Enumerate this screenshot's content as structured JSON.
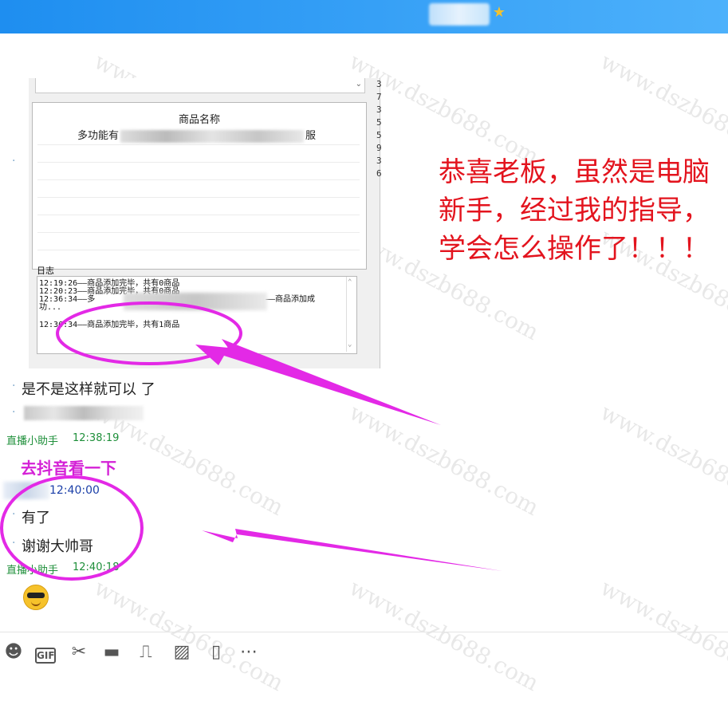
{
  "window": {
    "vip_icon": "vip-star-icon"
  },
  "watermark": "www.dszb688.com",
  "screenshot": {
    "product_header": "商品名称",
    "product_prefix": "多功能有",
    "product_suffix": "服",
    "log_label": "日志",
    "log_lines": [
      "12:19:26——商品添加完毕，共有0商品",
      "12:20:23——商品添加完毕，共有0商品",
      "12:36:34——多",
      "——商品添加成",
      "功...",
      "12:36:34——商品添加完毕，共有1商品"
    ],
    "side_digits": [
      "3",
      "7",
      "3",
      "5",
      "5",
      "9",
      "3",
      "6"
    ]
  },
  "messages": {
    "msg1": "是不是这样就可以 了",
    "sender1_name": "直播小助手",
    "sender1_time": "12:38:19",
    "sender2_time": "12:40:00",
    "msg2": "有了",
    "msg3": "谢谢大帅哥",
    "sender3_name": "直播小助手",
    "sender3_time": "12:40:18"
  },
  "annotations": {
    "pink_note": "去抖音看一下",
    "red_note": "恭喜老板，虽然是电脑新手，经过我的指导，学会怎么操作了！！！",
    "accent_pink": "#d421d6",
    "accent_red": "#e3141e"
  },
  "toolbar": {
    "icons": [
      "emoji-icon",
      "gif-icon",
      "scissors-icon",
      "folder-icon",
      "gift-icon",
      "image-icon",
      "phone-icon",
      "more-icon"
    ]
  }
}
